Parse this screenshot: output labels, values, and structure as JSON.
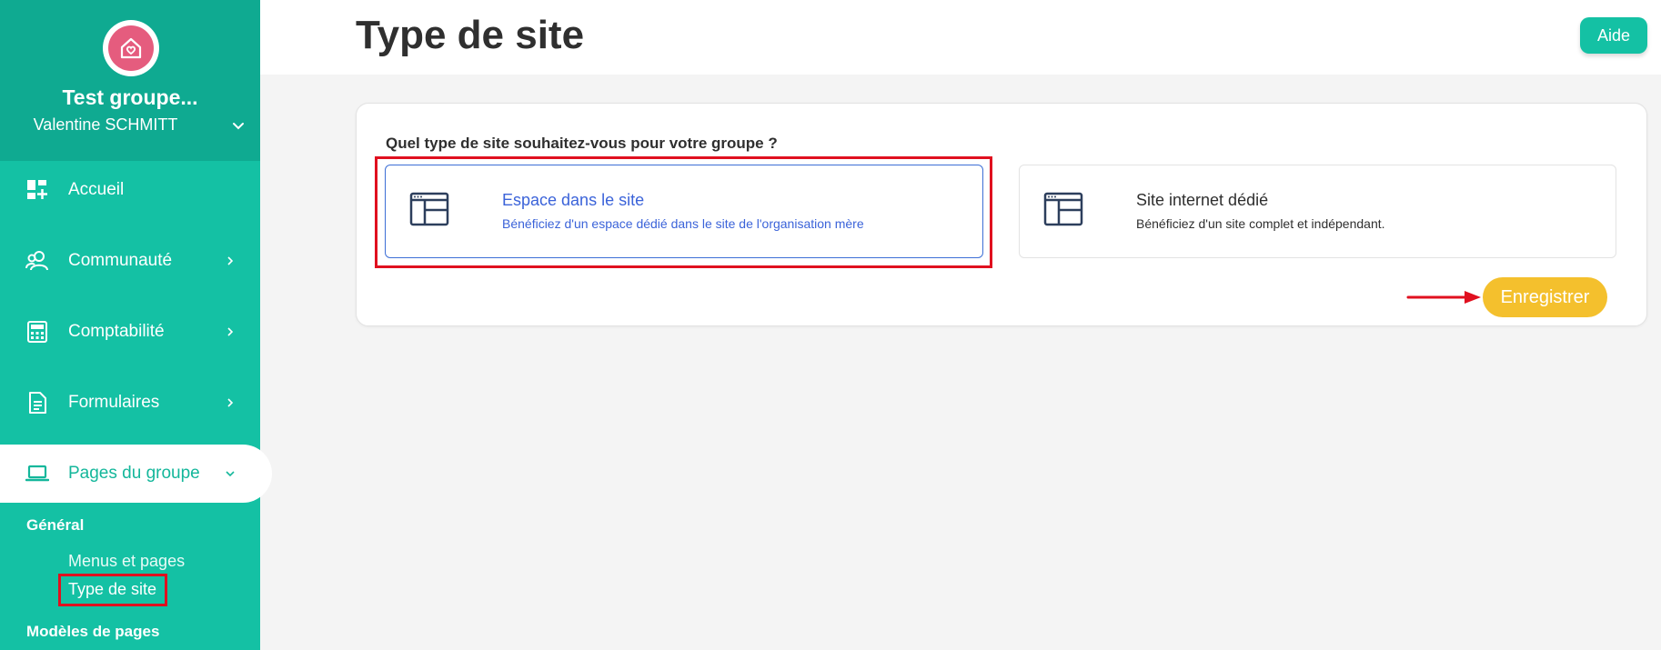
{
  "sidebar": {
    "group_name": "Test groupe...",
    "user_name": "Valentine SCHMITT",
    "items": [
      {
        "label": "Accueil",
        "icon": "dashboard-add-icon"
      },
      {
        "label": "Communauté",
        "icon": "users-icon"
      },
      {
        "label": "Comptabilité",
        "icon": "calculator-icon"
      },
      {
        "label": "Formulaires",
        "icon": "document-icon"
      },
      {
        "label": "Pages du groupe",
        "icon": "laptop-icon"
      }
    ],
    "section_general": "Général",
    "sub_items": [
      {
        "label": "Menus et pages"
      },
      {
        "label": "Type de site"
      }
    ],
    "section_models": "Modèles de pages"
  },
  "header": {
    "title": "Type de site",
    "help_label": "Aide"
  },
  "main": {
    "question": "Quel type de site souhaitez-vous pour votre groupe ?",
    "options": [
      {
        "title": "Espace dans le site",
        "description": "Bénéficiez d'un espace dédié dans le site de l'organisation mère",
        "selected": true
      },
      {
        "title": "Site internet dédié",
        "description": "Bénéficiez d'un site complet et indépendant.",
        "selected": false
      }
    ],
    "save_label": "Enregistrer"
  },
  "colors": {
    "brand": "#14c1a4",
    "brand_dark": "#0faa91",
    "accent": "#f4c02d",
    "selected_blue": "#3b63d9",
    "highlight_red": "#e0101f"
  }
}
